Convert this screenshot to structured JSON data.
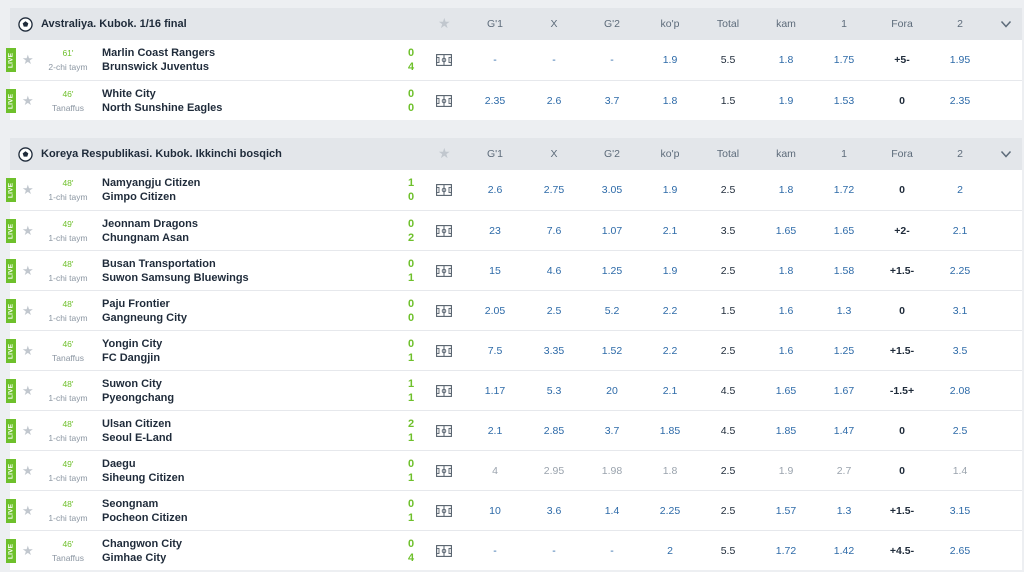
{
  "headers": [
    "G'1",
    "X",
    "G'2",
    "ko'p",
    "Total",
    "kam",
    "1",
    "Fora",
    "2"
  ],
  "live_badge": "LIVE",
  "sections": [
    {
      "league": "Avstraliya. Kubok. 1/16 final",
      "matches": [
        {
          "minute": "61'",
          "period": "2-chi taym",
          "team1": "Marlin Coast Rangers",
          "team2": "Brunswick Juventus",
          "score1": "0",
          "score2": "4",
          "odds": [
            "-",
            "-",
            "-",
            "1.9",
            "5.5",
            "1.8",
            "1.75",
            "+5-",
            "1.95"
          ]
        },
        {
          "minute": "46'",
          "period": "Tanaffus",
          "team1": "White City",
          "team2": "North Sunshine Eagles",
          "score1": "0",
          "score2": "0",
          "odds": [
            "2.35",
            "2.6",
            "3.7",
            "1.8",
            "1.5",
            "1.9",
            "1.53",
            "0",
            "2.35"
          ]
        }
      ]
    },
    {
      "league": "Koreya Respublikasi. Kubok. Ikkinchi bosqich",
      "matches": [
        {
          "minute": "48'",
          "period": "1-chi taym",
          "team1": "Namyangju Citizen",
          "team2": "Gimpo Citizen",
          "score1": "1",
          "score2": "0",
          "odds": [
            "2.6",
            "2.75",
            "3.05",
            "1.9",
            "2.5",
            "1.8",
            "1.72",
            "0",
            "2"
          ]
        },
        {
          "minute": "49'",
          "period": "1-chi taym",
          "team1": "Jeonnam Dragons",
          "team2": "Chungnam Asan",
          "score1": "0",
          "score2": "2",
          "odds": [
            "23",
            "7.6",
            "1.07",
            "2.1",
            "3.5",
            "1.65",
            "1.65",
            "+2-",
            "2.1"
          ]
        },
        {
          "minute": "48'",
          "period": "1-chi taym",
          "team1": "Busan Transportation",
          "team2": "Suwon Samsung Bluewings",
          "score1": "0",
          "score2": "1",
          "odds": [
            "15",
            "4.6",
            "1.25",
            "1.9",
            "2.5",
            "1.8",
            "1.58",
            "+1.5-",
            "2.25"
          ]
        },
        {
          "minute": "48'",
          "period": "1-chi taym",
          "team1": "Paju Frontier",
          "team2": "Gangneung City",
          "score1": "0",
          "score2": "0",
          "odds": [
            "2.05",
            "2.5",
            "5.2",
            "2.2",
            "1.5",
            "1.6",
            "1.3",
            "0",
            "3.1"
          ]
        },
        {
          "minute": "46'",
          "period": "Tanaffus",
          "team1": "Yongin City",
          "team2": "FC Dangjin",
          "score1": "0",
          "score2": "1",
          "odds": [
            "7.5",
            "3.35",
            "1.52",
            "2.2",
            "2.5",
            "1.6",
            "1.25",
            "+1.5-",
            "3.5"
          ]
        },
        {
          "minute": "48'",
          "period": "1-chi taym",
          "team1": "Suwon City",
          "team2": "Pyeongchang",
          "score1": "1",
          "score2": "1",
          "odds": [
            "1.17",
            "5.3",
            "20",
            "2.1",
            "4.5",
            "1.65",
            "1.67",
            "-1.5+",
            "2.08"
          ]
        },
        {
          "minute": "48'",
          "period": "1-chi taym",
          "team1": "Ulsan Citizen",
          "team2": "Seoul E-Land",
          "score1": "2",
          "score2": "1",
          "odds": [
            "2.1",
            "2.85",
            "3.7",
            "1.85",
            "4.5",
            "1.85",
            "1.47",
            "0",
            "2.5"
          ]
        },
        {
          "minute": "49'",
          "period": "1-chi taym",
          "team1": "Daegu",
          "team2": "Siheung Citizen",
          "score1": "0",
          "score2": "1",
          "odds": [
            "4",
            "2.95",
            "1.98",
            "1.8",
            "2.5",
            "1.9",
            "2.7",
            "0",
            "1.4"
          ],
          "suspended": true
        },
        {
          "minute": "48'",
          "period": "1-chi taym",
          "team1": "Seongnam",
          "team2": "Pocheon Citizen",
          "score1": "0",
          "score2": "1",
          "odds": [
            "10",
            "3.6",
            "1.4",
            "2.25",
            "2.5",
            "1.57",
            "1.3",
            "+1.5-",
            "3.15"
          ]
        },
        {
          "minute": "46'",
          "period": "Tanaffus",
          "team1": "Changwon City",
          "team2": "Gimhae City",
          "score1": "0",
          "score2": "4",
          "odds": [
            "-",
            "-",
            "-",
            "2",
            "5.5",
            "1.72",
            "1.42",
            "+4.5-",
            "2.65"
          ]
        }
      ]
    }
  ]
}
